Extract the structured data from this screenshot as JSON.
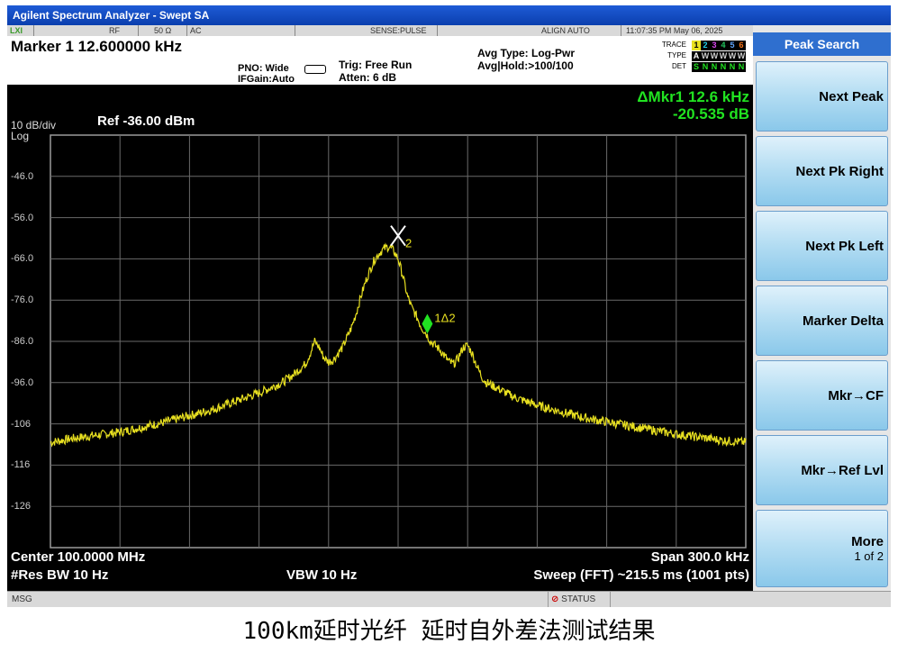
{
  "window": {
    "title": "Agilent Spectrum Analyzer - Swept SA"
  },
  "status_strip": {
    "logo": "LXI",
    "rf": "RF",
    "impedance": "50 Ω",
    "coupling": "AC",
    "sense": "SENSE:PULSE",
    "align": "ALIGN AUTO",
    "datetime": "11:07:35 PM May 06, 2025"
  },
  "header": {
    "marker_readout": "Marker 1 12.600000 kHz",
    "pno": "PNO: Wide",
    "ifgain": "IFGain:Auto",
    "trig": "Trig: Free Run",
    "atten": "Atten: 6 dB",
    "avg_type": "Avg Type: Log-Pwr",
    "avg_hold": "Avg|Hold:>100/100",
    "trace_label": "TRACE",
    "type_label": "TYPE",
    "det_label": "DET",
    "trace_digits": [
      "1",
      "2",
      "3",
      "4",
      "5",
      "6"
    ],
    "type_row": [
      "A",
      "W",
      "W",
      "W",
      "W",
      "W"
    ],
    "det_row": [
      "S",
      "N",
      "N",
      "N",
      "N",
      "N"
    ]
  },
  "display": {
    "scale": "10 dB/div",
    "log": "Log",
    "ref": "Ref -36.00 dBm",
    "delta_line1": "ΔMkr1 12.6 kHz",
    "delta_line2": "-20.535 dB",
    "y_labels": [
      "-46.0",
      "-56.0",
      "-66.0",
      "-76.0",
      "-86.0",
      "-96.0",
      "-106",
      "-116",
      "-126"
    ],
    "marker_x_label": "2",
    "marker_delta_label": "1Δ2",
    "center": "Center 100.0000 MHz",
    "res_bw": "#Res BW 10 Hz",
    "vbw": "VBW 10 Hz",
    "span": "Span 300.0 kHz",
    "sweep": "Sweep (FFT)  ~215.5 ms (1001 pts)"
  },
  "softkeys": {
    "title": "Peak Search",
    "items": [
      {
        "label": "Next Peak",
        "sub": ""
      },
      {
        "label": "Next Pk Right",
        "sub": ""
      },
      {
        "label": "Next Pk Left",
        "sub": ""
      },
      {
        "label": "Marker Delta",
        "sub": ""
      },
      {
        "label": "Mkr→CF",
        "sub": ""
      },
      {
        "label": "Mkr→Ref Lvl",
        "sub": ""
      },
      {
        "label": "More",
        "sub": "1 of 2"
      }
    ]
  },
  "message_bar": {
    "msg": "MSG",
    "status": "STATUS"
  },
  "caption": "100km延时光纤 延时自外差法测试结果",
  "colors": {
    "trace": "#e8e020",
    "delta_marker": "#21e321",
    "grid": "#6a6a6a",
    "readout": "#21e321"
  },
  "chart_data": {
    "type": "line",
    "x_unit": "kHz offset from center",
    "xlim": [
      -150,
      150
    ],
    "ylim": [
      -136,
      -36
    ],
    "y_unit": "dBm",
    "series": [
      {
        "x": [
          -150,
          -140,
          -120,
          -100,
          -80,
          -60,
          -50,
          -45,
          -40,
          -38,
          -36,
          -34,
          -32,
          -30,
          -28,
          -26,
          -24,
          -22,
          -20,
          -18,
          -16,
          -14,
          -12,
          -10,
          -8,
          -6,
          -4,
          -2,
          0,
          2,
          4,
          6,
          8,
          10,
          12,
          14,
          16,
          18,
          20,
          22,
          24,
          26,
          28,
          30,
          32,
          34,
          36,
          38,
          40,
          45,
          50,
          60,
          80,
          100,
          120,
          140,
          150
        ],
        "y": [
          -110.5,
          -109.5,
          -108,
          -105.5,
          -102.5,
          -98.5,
          -96,
          -94,
          -91.5,
          -89,
          -86,
          -87.5,
          -90,
          -91,
          -90.5,
          -89,
          -87.5,
          -85,
          -82.5,
          -79,
          -75,
          -71.5,
          -68.5,
          -66,
          -64.5,
          -63.5,
          -63,
          -64,
          -66,
          -70,
          -75,
          -78,
          -80,
          -82.5,
          -84,
          -86,
          -87,
          -88,
          -89.5,
          -91,
          -91.5,
          -90,
          -87.5,
          -87,
          -89,
          -92,
          -94.5,
          -96,
          -96.5,
          -98,
          -99.5,
          -101.5,
          -104.5,
          -106.5,
          -108.5,
          -110,
          -110.5
        ]
      }
    ],
    "markers": [
      {
        "name": "2",
        "x": 0,
        "y": -63
      },
      {
        "name": "1Δ2",
        "x": 12.6,
        "y": -83.5
      }
    ]
  }
}
